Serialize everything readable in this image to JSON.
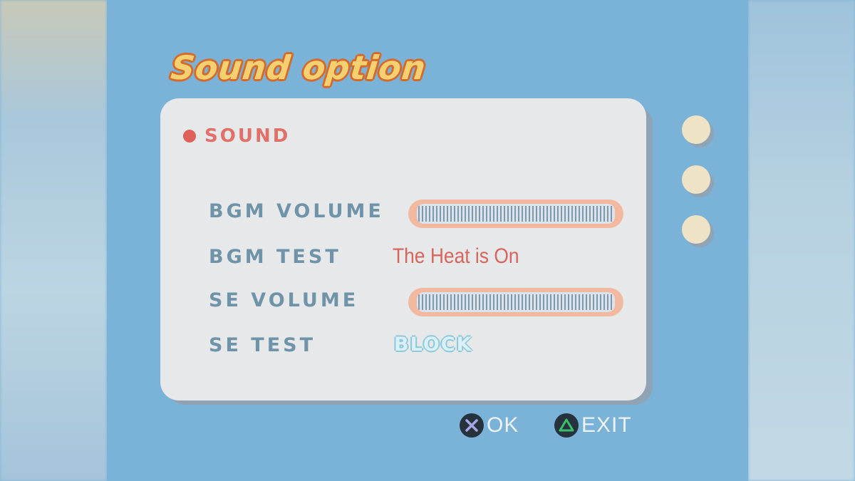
{
  "title": "Sound option",
  "section": {
    "label": "SOUND"
  },
  "rows": {
    "bgm_volume": {
      "label": "BGM VOLUME",
      "level": 1.0
    },
    "bgm_test": {
      "label": "BGM TEST",
      "value": "The Heat is On"
    },
    "se_volume": {
      "label": "SE VOLUME",
      "level": 1.0
    },
    "se_test": {
      "label": "SE TEST",
      "value": "BLOCK"
    }
  },
  "page_indicators": 3,
  "controls": {
    "ok": {
      "icon": "cross-button-icon",
      "label": "OK"
    },
    "exit": {
      "icon": "triangle-button-icon",
      "label": "EXIT"
    }
  },
  "colors": {
    "background": "#7ab2d8",
    "panel": "#e6e8ea",
    "accent": "#e07068",
    "label": "#6f93a8"
  }
}
